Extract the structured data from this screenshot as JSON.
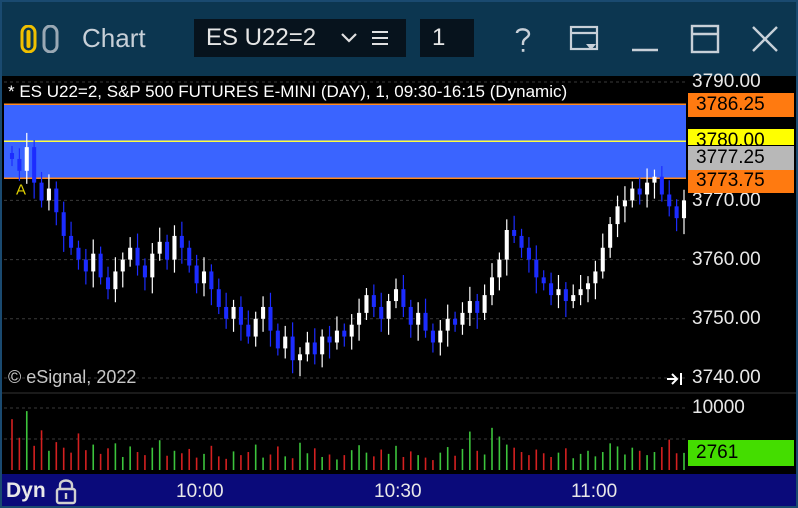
{
  "titlebar": {
    "app_title": "Chart",
    "symbol": "ES U22=2",
    "interval": "1"
  },
  "chart_header": "* ES U22=2, S&P 500 FUTURES E-MINI (DAY), 1, 09:30-16:15 (Dynamic)",
  "copyright": "© eSignal, 2022",
  "price_axis": [
    "3790.00",
    "3770.00",
    "3760.00",
    "3750.00",
    "3740.00"
  ],
  "price_boxes": {
    "upper_level": "3786.25",
    "mid_level": "3780.00",
    "last_price": "3777.25",
    "lower_level": "3773.75"
  },
  "volume_axis": {
    "top_label": "10000",
    "last_volume": "2761"
  },
  "time_axis": [
    "10:00",
    "10:30",
    "11:00"
  ],
  "bottom_bar": {
    "mode_label": "Dyn"
  },
  "annotation_letter": "A",
  "colors": {
    "titlebar_bg": "#0c3650",
    "band_fill": "#3a64ff",
    "band_line": "#ff8a1e",
    "mid_line": "#ffff40",
    "up_candle": "#ffffff",
    "down_candle": "#1c2cff",
    "volume_up": "#3cc43c",
    "volume_down": "#d42020",
    "last_volume_bg": "#44dd00",
    "upper_box_bg": "#ff7a10",
    "mid_box_bg": "#ffff00",
    "last_box_bg": "#b8b8b8"
  },
  "chart_data": {
    "type": "candlestick",
    "title": "ES U22=2, S&P 500 FUTURES E-MINI (DAY), 1, 09:30-16:15 (Dynamic)",
    "xlabel": "",
    "ylabel": "",
    "ylim": [
      3740,
      3790
    ],
    "x_ticks": [
      "10:00",
      "10:30",
      "11:00"
    ],
    "bars_shown": 92,
    "levels": {
      "upper": 3786.25,
      "mid": 3780.0,
      "last": 3777.25,
      "lower": 3773.75
    },
    "closes": [
      3777,
      3775,
      3779,
      3773,
      3770,
      3772,
      3768,
      3764,
      3762,
      3760,
      3758,
      3761,
      3757,
      3755,
      3758,
      3760,
      3762,
      3759,
      3757,
      3761,
      3763,
      3760,
      3764,
      3762,
      3759,
      3756,
      3758,
      3755,
      3752,
      3750,
      3752,
      3749,
      3747,
      3750,
      3752,
      3748,
      3745,
      3747,
      3743,
      3744,
      3746,
      3744,
      3747,
      3746,
      3748,
      3747,
      3749,
      3751,
      3754,
      3752,
      3750,
      3753,
      3755,
      3752,
      3749,
      3751,
      3748,
      3746,
      3748,
      3750,
      3749,
      3751,
      3753,
      3751,
      3754,
      3757,
      3760,
      3765,
      3764,
      3762,
      3760,
      3757,
      3756,
      3754,
      3755,
      3753,
      3754,
      3755,
      3756,
      3758,
      3762,
      3766,
      3769,
      3770,
      3772,
      3771,
      3773,
      3774,
      3771,
      3769,
      3767,
      3770
    ],
    "volume": [
      8200,
      5200,
      9500,
      3900,
      6400,
      3100,
      4500,
      3600,
      2800,
      5900,
      3200,
      4100,
      2600,
      3500,
      4300,
      2100,
      3800,
      2900,
      2400,
      3600,
      4800,
      2300,
      3100,
      2700,
      3400,
      2000,
      2600,
      3900,
      2200,
      1800,
      3000,
      2400,
      2900,
      4100,
      2000,
      2500,
      3800,
      2200,
      1900,
      4400,
      2700,
      3500,
      2100,
      2500,
      1700,
      2400,
      3200,
      4000,
      2800,
      2200,
      3300,
      2600,
      3900,
      2100,
      3000,
      2400,
      2000,
      1600,
      2800,
      3700,
      2300,
      3400,
      6200,
      3100,
      2500,
      6800,
      5400,
      4100,
      3600,
      2900,
      2400,
      3300,
      2700,
      2100,
      2800,
      3500,
      1900,
      2600,
      3100,
      2200,
      2900,
      4300,
      3800,
      2500,
      3600,
      3100,
      2400,
      2900,
      3700,
      4900,
      2700,
      2761
    ]
  }
}
